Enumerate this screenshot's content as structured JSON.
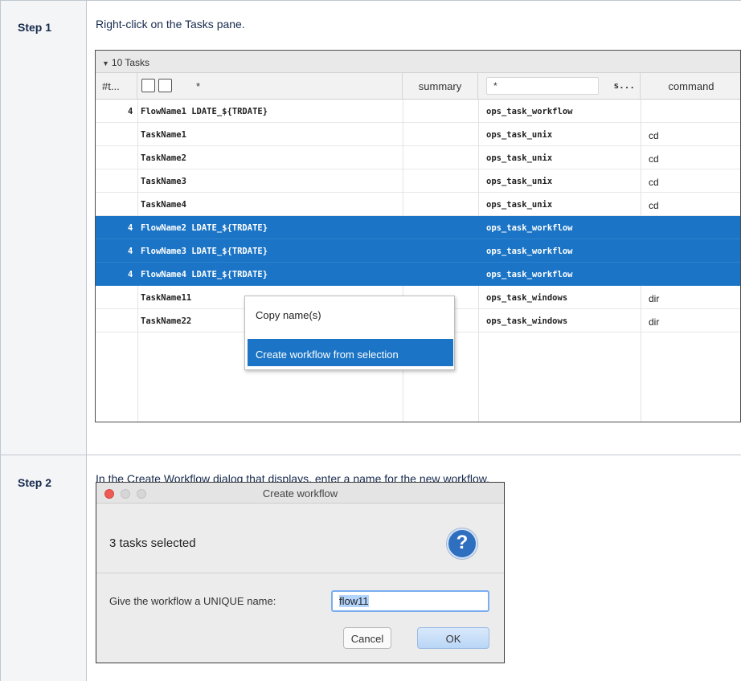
{
  "steps": [
    {
      "label": "Step 1",
      "text": "Right-click on the Tasks pane."
    },
    {
      "label": "Step 2",
      "text": "In the Create Workflow dialog that displays, enter a name for the new workflow."
    }
  ],
  "tasks_pane": {
    "title": "10 Tasks",
    "headers": {
      "num": "#t...",
      "filter1": "*",
      "summary": "summary",
      "filter2": "*",
      "s": "s...",
      "command": "command"
    },
    "rows": [
      {
        "num": "4",
        "name": "FlowName1 LDATE_${TRDATE}",
        "type": "ops_task_workflow",
        "command": "",
        "selected": false
      },
      {
        "num": "",
        "name": "TaskName1",
        "type": "ops_task_unix",
        "command": "cd",
        "selected": false
      },
      {
        "num": "",
        "name": "TaskName2",
        "type": "ops_task_unix",
        "command": "cd",
        "selected": false
      },
      {
        "num": "",
        "name": "TaskName3",
        "type": "ops_task_unix",
        "command": "cd",
        "selected": false
      },
      {
        "num": "",
        "name": "TaskName4",
        "type": "ops_task_unix",
        "command": "cd",
        "selected": false
      },
      {
        "num": "4",
        "name": "FlowName2 LDATE_${TRDATE}",
        "type": "ops_task_workflow",
        "command": "",
        "selected": true
      },
      {
        "num": "4",
        "name": "FlowName3 LDATE_${TRDATE}",
        "type": "ops_task_workflow",
        "command": "",
        "selected": true
      },
      {
        "num": "4",
        "name": "FlowName4 LDATE_${TRDATE}",
        "type": "ops_task_workflow",
        "command": "",
        "selected": true
      },
      {
        "num": "",
        "name": "TaskName11",
        "type": "ops_task_windows",
        "command": "dir",
        "selected": false
      },
      {
        "num": "",
        "name": "TaskName22",
        "type": "ops_task_windows",
        "command": "dir",
        "selected": false
      }
    ]
  },
  "context_menu": {
    "items": [
      "Copy name(s)",
      "Create workflow from selection"
    ],
    "highlighted_index": 1
  },
  "dialog": {
    "title": "Create workflow",
    "message": "3 tasks selected",
    "help_glyph": "?",
    "label": "Give the workflow a UNIQUE name:",
    "value": "flow11",
    "cancel": "Cancel",
    "ok": "OK"
  },
  "colors": {
    "selection": "#1b74c5",
    "close_light": "#ee5b54",
    "inactive_light": "#d6d6d6"
  }
}
